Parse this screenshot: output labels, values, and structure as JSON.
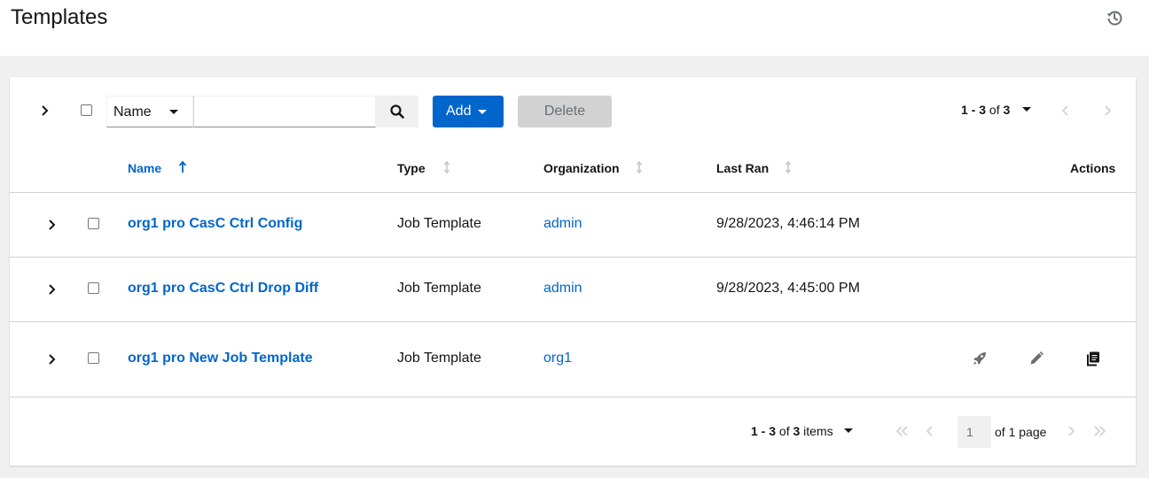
{
  "header": {
    "title": "Templates",
    "history_icon": "history-icon"
  },
  "toolbar": {
    "filter_by": "Name",
    "search_value": "",
    "add_label": "Add",
    "delete_label": "Delete",
    "pagination": {
      "range": "1 - 3",
      "of_word": "of",
      "total": "3"
    }
  },
  "table": {
    "columns": [
      {
        "label": "Name",
        "sort": "ascending"
      },
      {
        "label": "Type",
        "sort": "none"
      },
      {
        "label": "Organization",
        "sort": "none"
      },
      {
        "label": "Last Ran",
        "sort": "none"
      },
      {
        "label": "Actions"
      }
    ],
    "rows": [
      {
        "name": "org1 pro CasC Ctrl Config",
        "type": "Job Template",
        "organization": "admin",
        "last_ran": "9/28/2023, 4:46:14 PM",
        "actions": []
      },
      {
        "name": "org1 pro CasC Ctrl Drop Diff",
        "type": "Job Template",
        "organization": "admin",
        "last_ran": "9/28/2023, 4:45:00 PM",
        "actions": []
      },
      {
        "name": "org1 pro New Job Template",
        "type": "Job Template",
        "organization": "org1",
        "last_ran": "",
        "actions": [
          "rocket-icon",
          "pencil-icon",
          "copy-icon"
        ]
      }
    ]
  },
  "bottom_pagination": {
    "range": "1 - 3",
    "of_word": "of",
    "total": "3",
    "items_word": "items",
    "page": "1",
    "of_pages": "of 1 page"
  },
  "colors": {
    "link": "#0066cc",
    "primary_button": "#0066cc",
    "disabled_button": "#d2d2d2",
    "page_background": "#f0f0f0"
  }
}
